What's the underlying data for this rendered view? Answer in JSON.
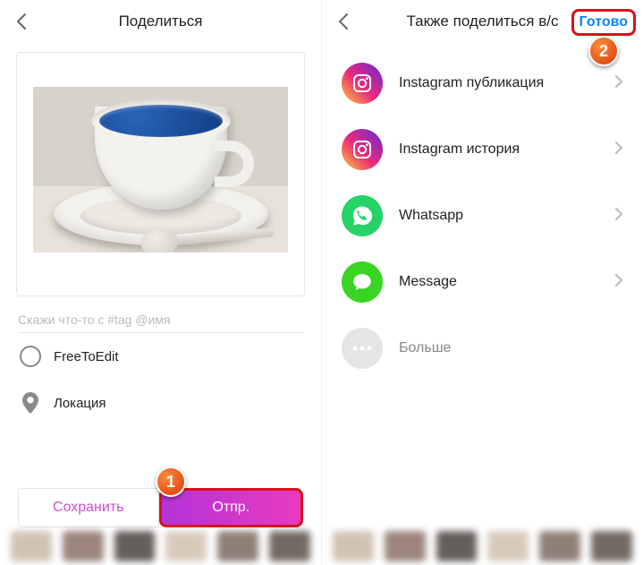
{
  "left": {
    "header_title": "Поделиться",
    "caption_placeholder": "Скажи что-то с #tag @имя",
    "free_to_edit_label": "FreeToEdit",
    "location_label": "Локация",
    "save_label": "Сохранить",
    "send_label": "Отпр."
  },
  "right": {
    "header_title": "Также поделиться в/с",
    "done_label": "Готово",
    "items": [
      {
        "label": "Instagram публикация",
        "icon": "instagram"
      },
      {
        "label": "Instagram история",
        "icon": "instagram"
      },
      {
        "label": "Whatsapp",
        "icon": "whatsapp"
      },
      {
        "label": "Message",
        "icon": "message"
      },
      {
        "label": "Больше",
        "icon": "more"
      }
    ]
  },
  "steps": {
    "one": "1",
    "two": "2"
  }
}
